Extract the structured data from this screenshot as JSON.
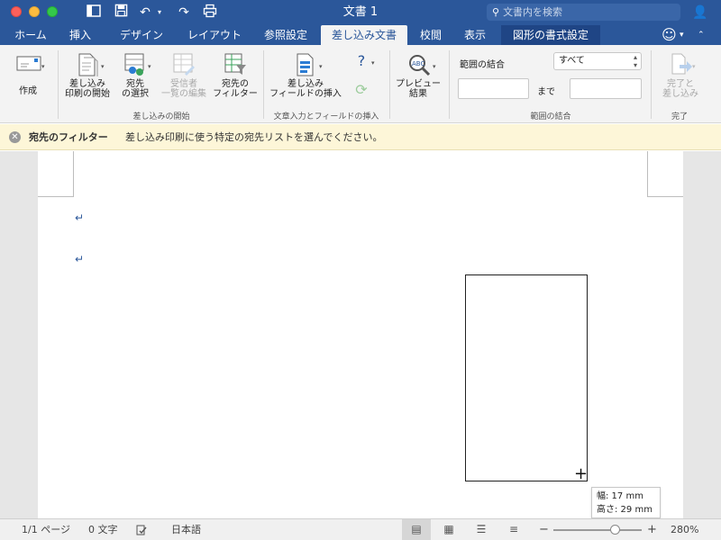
{
  "window": {
    "title": "文書 1",
    "search_placeholder": "文書内を検索"
  },
  "tabs": [
    {
      "label": "ホーム"
    },
    {
      "label": "挿入"
    },
    {
      "label": "デザイン"
    },
    {
      "label": "レイアウト"
    },
    {
      "label": "参照設定"
    },
    {
      "label": "差し込み文書",
      "active": true
    },
    {
      "label": "校閲"
    },
    {
      "label": "表示"
    },
    {
      "label": "図形の書式設定"
    }
  ],
  "ribbon": {
    "create": {
      "label": "作成"
    },
    "start_merge": {
      "line1": "差し込み",
      "line2": "印刷の開始"
    },
    "select_recipients": {
      "line1": "宛先",
      "line2": "の選択"
    },
    "edit_recipients": {
      "line1": "受信者",
      "line2": "一覧の編集"
    },
    "filter_recipients": {
      "line1": "宛先の",
      "line2": "フィルター"
    },
    "group_start": "差し込みの開始",
    "insert_field": {
      "line1": "差し込み",
      "line2": "フィールドの挿入"
    },
    "group_insert": "文章入力とフィールドの挿入",
    "preview": {
      "line1": "プレビュー",
      "line2": "結果"
    },
    "range": {
      "label": "範囲の結合",
      "select_value": "すべて",
      "to_label": "まで",
      "group_label": "範囲の結合"
    },
    "finish": {
      "line1": "完了と",
      "line2": "差し込み",
      "group_label": "完了"
    }
  },
  "message_bar": {
    "title": "宛先のフィルター",
    "text": "差し込み印刷に使う特定の宛先リストを選んでください。"
  },
  "document": {
    "paragraph_mark": "↵",
    "tooltip": {
      "width": "幅: 17 mm",
      "height": "高さ: 29 mm"
    }
  },
  "status": {
    "pages": "1/1 ページ",
    "words": "0 文字",
    "language": "日本語",
    "zoom_minus": "−",
    "zoom_plus": "+",
    "zoom": "280%",
    "zoom_fraction": 0.7
  }
}
